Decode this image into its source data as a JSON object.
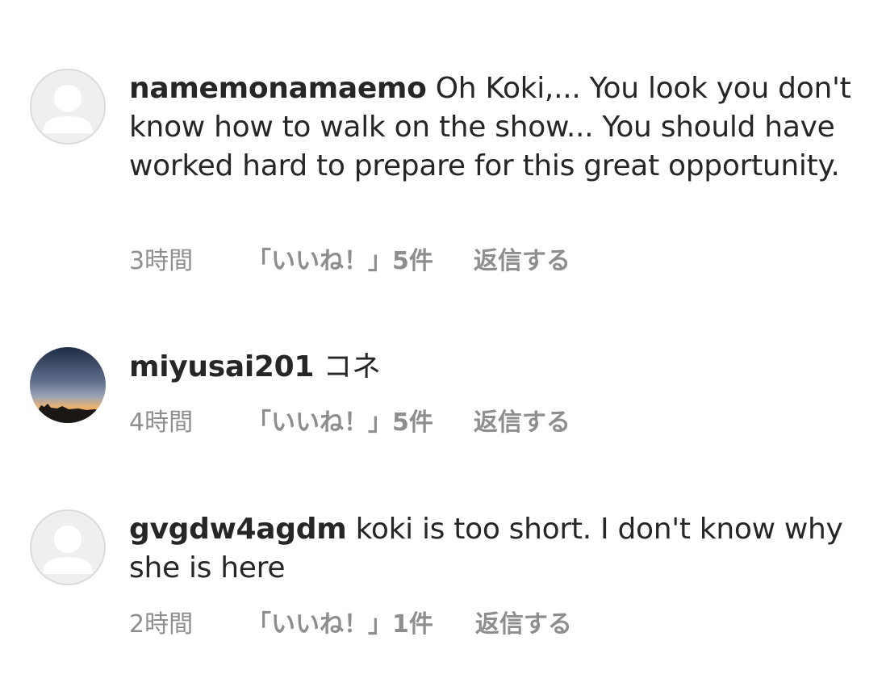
{
  "comments": [
    {
      "username": "namemonamaemo",
      "text": "Oh Koki,... You look you don't know how to walk on the show... You should have worked hard to prepare for this great opportunity.",
      "time": "3時間",
      "likes": "「いいね！」5件",
      "reply": "返信する",
      "avatar": "default-avatar-icon"
    },
    {
      "username": "miyusai201",
      "text": "コネ",
      "time": "4時間",
      "likes": "「いいね！」5件",
      "reply": "返信する",
      "avatar": "sunset-photo-avatar"
    },
    {
      "username": "gvgdw4agdm",
      "text": "koki is too short. I don't know why she is here",
      "time": "2時間",
      "likes": "「いいね！」1件",
      "reply": "返信する",
      "avatar": "default-avatar-icon"
    }
  ],
  "colors": {
    "text": "#262626",
    "meta": "#8e8e8e",
    "avatar_bg": "#efefef",
    "avatar_figure": "#ffffff"
  }
}
